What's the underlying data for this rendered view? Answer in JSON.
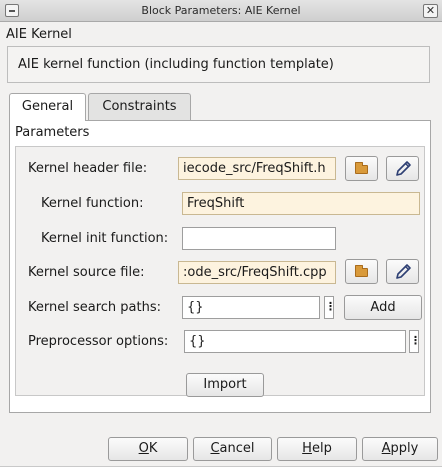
{
  "window": {
    "title": "Block Parameters: AIE Kernel"
  },
  "block": {
    "name": "AIE Kernel",
    "description": "AIE kernel function (including function template)"
  },
  "tabs": [
    {
      "label": "General",
      "active": true
    },
    {
      "label": "Constraints",
      "active": false
    }
  ],
  "parameters": {
    "section_label": "Parameters",
    "kernel_header_file": {
      "label": "Kernel header file:",
      "value": "iecode_src/FreqShift.h"
    },
    "kernel_function": {
      "label": "Kernel function:",
      "value": "FreqShift"
    },
    "kernel_init_function": {
      "label": "Kernel init function:",
      "value": ""
    },
    "kernel_source_file": {
      "label": "Kernel source file:",
      "value": ":ode_src/FreqShift.cpp"
    },
    "kernel_search_paths": {
      "label": "Kernel search paths:",
      "value": "{}",
      "add_label": "Add"
    },
    "preprocessor_options": {
      "label": "Preprocessor options:",
      "value": "{}"
    }
  },
  "import_label": "Import",
  "dialog_buttons": {
    "ok": {
      "mnemonic": "O",
      "rest": "K"
    },
    "cancel": {
      "mnemonic": "C",
      "rest": "ancel"
    },
    "help": {
      "mnemonic": "H",
      "rest": "elp"
    },
    "apply": {
      "mnemonic": "A",
      "rest": "pply"
    }
  },
  "icons": {
    "browse": "folder-icon",
    "edit": "pencil-icon",
    "menu": "vertical-dots-icon"
  },
  "colors": {
    "filled_field_bg": "#fdf3df",
    "folder": "#d99a3a",
    "pencil": "#2d3f73"
  }
}
